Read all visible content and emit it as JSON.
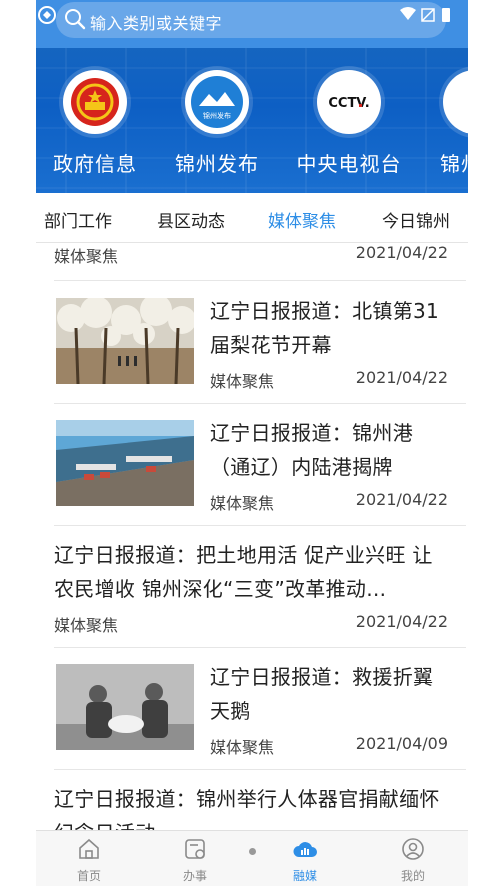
{
  "search": {
    "placeholder": "输入类别或关键字"
  },
  "banner": {
    "items": [
      {
        "label": "政府信息",
        "icon": "national-emblem-icon"
      },
      {
        "label": "锦州发布",
        "icon": "jinzhou-release-icon",
        "badge": "锦州发布"
      },
      {
        "label": "中央电视台",
        "icon": "cctv-logo-icon",
        "badge": "CCTV."
      },
      {
        "label": "锦州",
        "icon": "partial-channel-icon"
      }
    ]
  },
  "tabs": [
    {
      "label": "部门工作",
      "active": false
    },
    {
      "label": "县区动态",
      "active": false
    },
    {
      "label": "媒体聚焦",
      "active": true
    },
    {
      "label": "今日锦州",
      "active": false
    }
  ],
  "articles": [
    {
      "title": "",
      "category": "媒体聚焦",
      "date": "2021/04/22",
      "thumb": null
    },
    {
      "title": "辽宁日报报道：北镇第31届梨花节开幕",
      "category": "媒体聚焦",
      "date": "2021/04/22",
      "thumb": "pear-blossom-orchard"
    },
    {
      "title": "辽宁日报报道：锦州港（通辽）内陆港揭牌",
      "category": "媒体聚焦",
      "date": "2021/04/22",
      "thumb": "port-aerial-view"
    },
    {
      "title": "辽宁日报报道：把土地用活 促产业兴旺 让农民增收 锦州深化“三变”改革推动…",
      "category": "媒体聚焦",
      "date": "2021/04/22",
      "thumb": null
    },
    {
      "title": "辽宁日报报道：救援折翼天鹅",
      "category": "媒体聚焦",
      "date": "2021/04/09",
      "thumb": "swan-rescue-photo"
    },
    {
      "title": "辽宁日报报道：锦州举行人体器官捐献缅怀纪念日活动",
      "category": "",
      "date": "",
      "thumb": null
    }
  ],
  "bottom_nav": [
    {
      "label": "首页",
      "icon": "home-icon",
      "active": false
    },
    {
      "label": "办事",
      "icon": "service-icon",
      "active": false
    },
    {
      "label": "融媒",
      "icon": "cloud-media-icon",
      "active": true
    },
    {
      "label": "我的",
      "icon": "profile-icon",
      "active": false
    }
  ],
  "colors": {
    "accent": "#2e8ee6",
    "header": "#3f8fe3",
    "banner": "#1565c0"
  }
}
